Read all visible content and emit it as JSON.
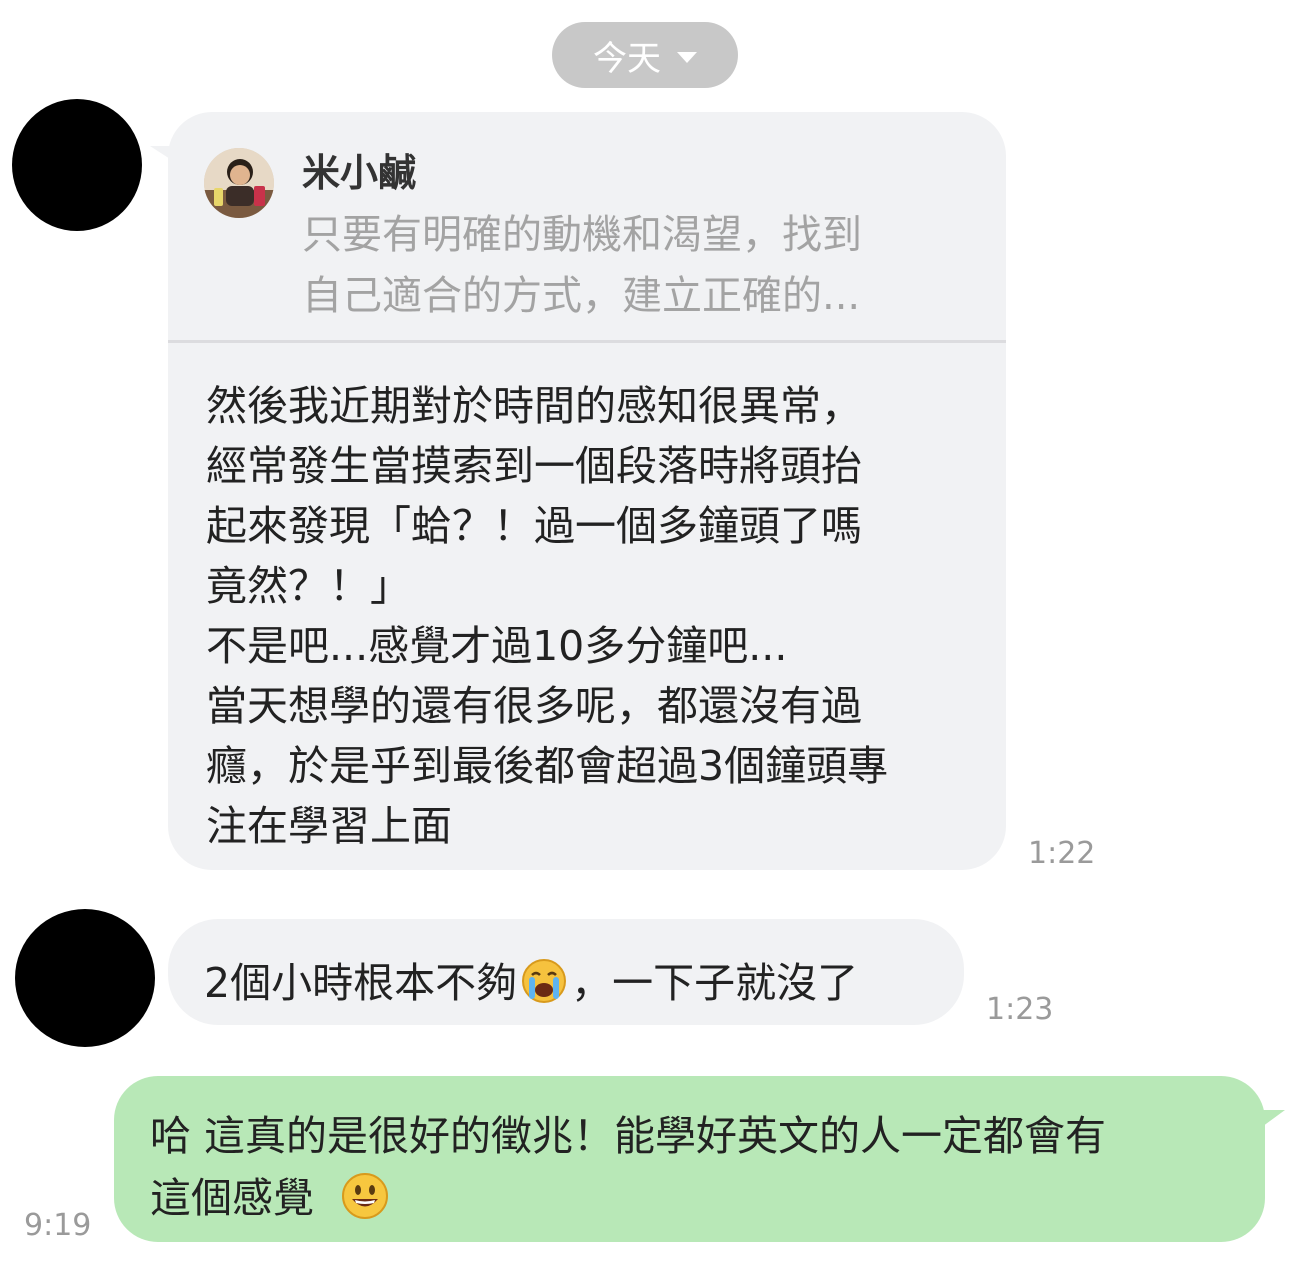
{
  "date_separator": {
    "label": "今天"
  },
  "messages": [
    {
      "reply": {
        "name": "米小鹹",
        "preview_lines": [
          "只要有明確的動機和渴望，找到",
          "自己適合的方式，建立正確的..."
        ]
      },
      "lines": [
        "然後我近期對於時間的感知很異常，",
        "經常發生當摸索到一個段落時將頭抬",
        "起來發現「蛤？！過一個多鐘頭了嗎",
        "竟然？！」",
        "不是吧...感覺才過10多分鐘吧...",
        "當天想學的還有很多呢，都還沒有過",
        "癮，於是乎到最後都會超過3個鐘頭專",
        "注在學習上面"
      ],
      "time": "1:22"
    },
    {
      "text_before": "2個小時根本不夠",
      "emoji": "loudly-crying-face",
      "text_after": "，一下子就沒了",
      "time": "1:23"
    },
    {
      "lines": [
        "哈 這真的是很好的徵兆！能學好英文的人一定都會有",
        "這個感覺"
      ],
      "emoji": "smiling-face",
      "time": "9:19"
    }
  ],
  "colors": {
    "incoming_bubble": "#f1f2f4",
    "outgoing_bubble": "#b8e8b7",
    "date_pill": "#c8c8c8",
    "time_text": "#9a9a9a"
  }
}
